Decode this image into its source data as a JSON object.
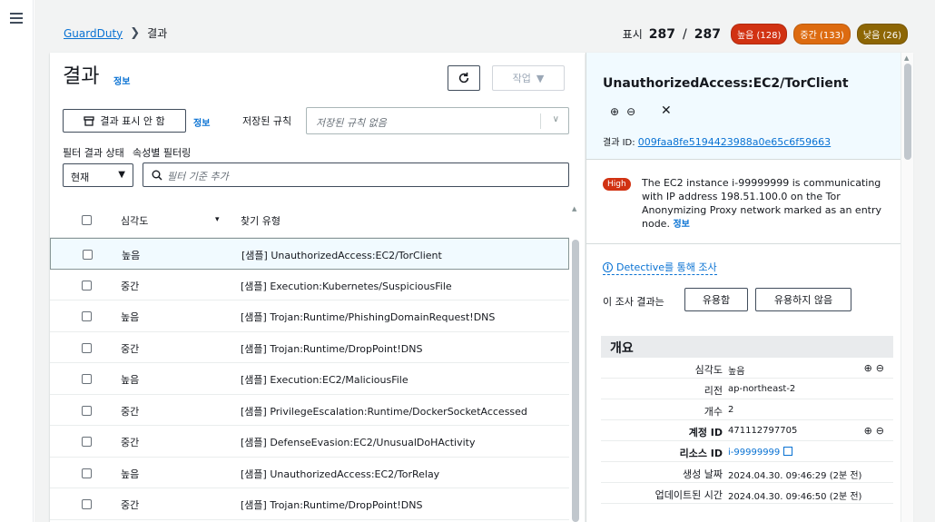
{
  "breadcrumb": {
    "root": "GuardDuty",
    "current": "결과"
  },
  "counts": {
    "label": "표시",
    "shown": "287",
    "total": "287",
    "high": "높음 (128)",
    "medium": "중간 (133)",
    "low": "낮음 (26)"
  },
  "findings_panel": {
    "title": "결과",
    "info": "정보",
    "actions_label": "작업",
    "hide_button": "결과 표시 안 함",
    "hide_info": "정보",
    "saved_rules_label": "저장된 규칙",
    "saved_rules_placeholder": "저장된 규칙 없음",
    "filter_state_label": "필터 결과 상태",
    "attr_filter_label": "속성별 필터링",
    "state_value": "현재",
    "filter_placeholder": "필터 기준 추가",
    "columns": {
      "severity": "심각도",
      "type": "찾기 유형"
    },
    "rows": [
      {
        "severity": "높음",
        "type": "[샘플] UnauthorizedAccess:EC2/TorClient",
        "selected": true
      },
      {
        "severity": "중간",
        "type": "[샘플] Execution:Kubernetes/SuspiciousFile",
        "selected": false
      },
      {
        "severity": "높음",
        "type": "[샘플] Trojan:Runtime/PhishingDomainRequest!DNS",
        "selected": false
      },
      {
        "severity": "중간",
        "type": "[샘플] Trojan:Runtime/DropPoint!DNS",
        "selected": false
      },
      {
        "severity": "높음",
        "type": "[샘플] Execution:EC2/MaliciousFile",
        "selected": false
      },
      {
        "severity": "중간",
        "type": "[샘플] PrivilegeEscalation:Runtime/DockerSocketAccessed",
        "selected": false
      },
      {
        "severity": "중간",
        "type": "[샘플] DefenseEvasion:EC2/UnusualDoHActivity",
        "selected": false
      },
      {
        "severity": "높음",
        "type": "[샘플] UnauthorizedAccess:EC2/TorRelay",
        "selected": false
      },
      {
        "severity": "중간",
        "type": "[샘플] Trojan:Runtime/DropPoint!DNS",
        "selected": false
      }
    ]
  },
  "detail": {
    "title": "UnauthorizedAccess:EC2/TorClient",
    "id_label": "결과 ID: ",
    "id_value": "009faa8fe5194423988a0e65c6f59663",
    "badge": "High",
    "description": "The EC2 instance i-99999999 is communicating with IP address 198.51.100.0 on the Tor Anonymizing Proxy network marked as an entry node. ",
    "desc_info": "정보",
    "detective_link": "Detective를 통해 조사",
    "useful_label": "이 조사 결과는",
    "useful_btn": "유용함",
    "not_useful_btn": "유용하지 않음",
    "overview_title": "개요",
    "overview": [
      {
        "key": "심각도",
        "value": "높음",
        "zoom": true,
        "link": false
      },
      {
        "key": "리전",
        "value": "ap-northeast-2",
        "zoom": false,
        "link": false
      },
      {
        "key": "개수",
        "value": "2",
        "zoom": false,
        "link": false
      },
      {
        "key": "계정 ID",
        "value": "471112797705",
        "zoom": true,
        "link": false
      },
      {
        "key": "리소스 ID",
        "value": "i-99999999",
        "zoom": false,
        "link": true
      },
      {
        "key": "생성 날짜",
        "value": "2024.04.30. 09:46:29 (2분 전)",
        "zoom": false,
        "link": false
      },
      {
        "key": "업데이트된 시간",
        "value": "2024.04.30. 09:46:50 (2분 전)",
        "zoom": false,
        "link": false
      }
    ]
  },
  "colors": {
    "link": "#0972d3",
    "high": "#d13212",
    "medium": "#dd6b10",
    "low": "#8d6605"
  }
}
